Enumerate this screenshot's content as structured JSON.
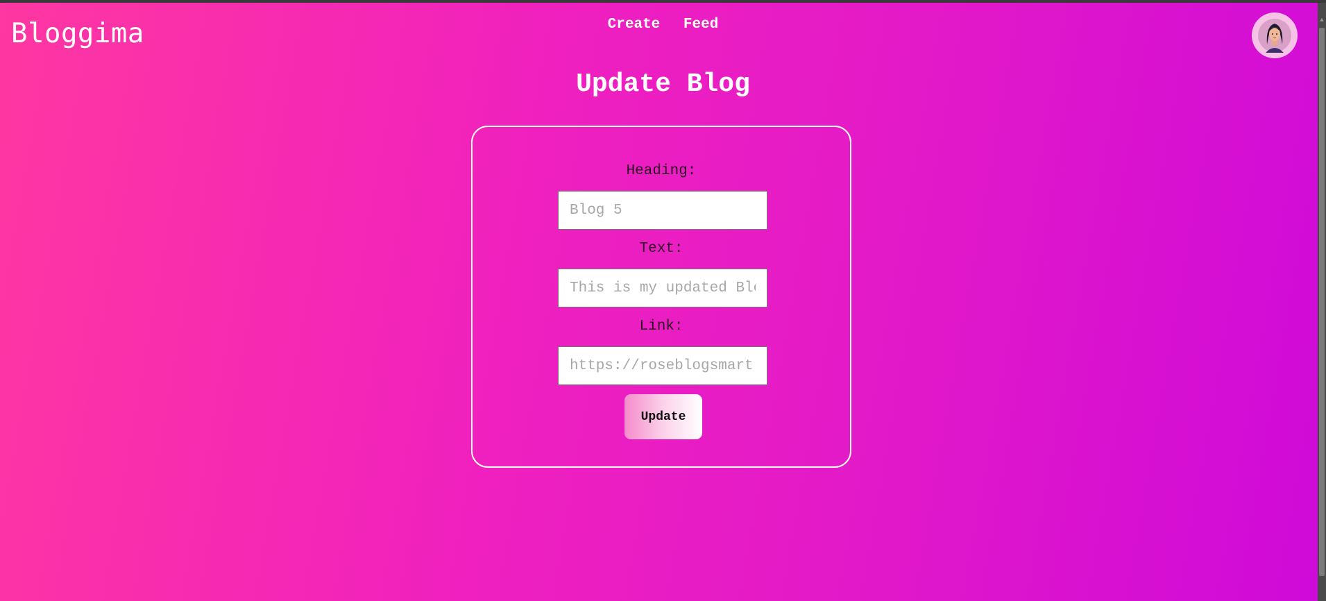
{
  "header": {
    "brand": "Bloggima",
    "nav": [
      {
        "label": "Create"
      },
      {
        "label": "Feed"
      }
    ],
    "avatar_icon": "user-avatar-icon"
  },
  "main": {
    "title": "Update Blog",
    "form": {
      "heading_label": "Heading:",
      "heading_placeholder": "Blog 5",
      "text_label": "Text:",
      "text_placeholder": "This is my updated Blog",
      "link_label": "Link:",
      "link_placeholder": "https://roseblogsmart",
      "submit_label": "Update"
    }
  },
  "colors": {
    "gradient_start": "#ff37a1",
    "gradient_end": "#cf0ad8",
    "text_light": "#ffffff",
    "card_border": "#ffffff"
  }
}
